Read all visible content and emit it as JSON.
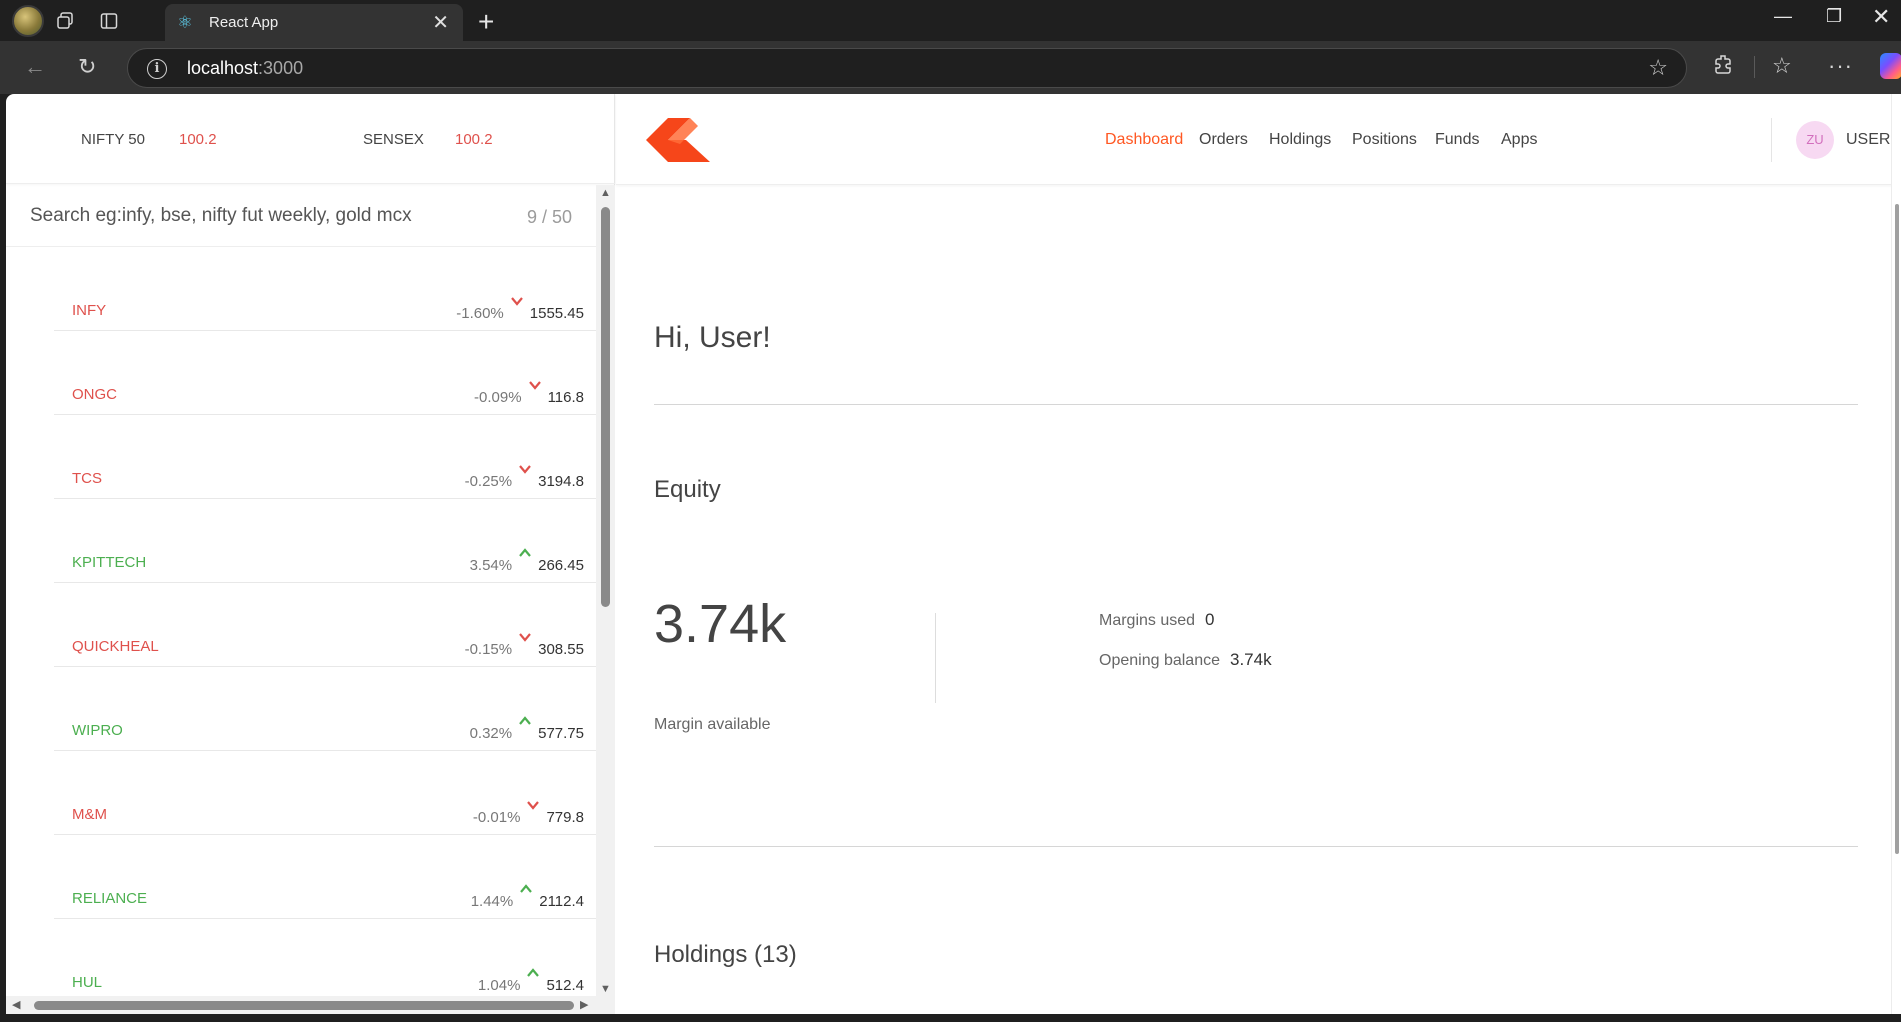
{
  "browser": {
    "tab_title": "React App",
    "url_host": "localhost",
    "url_port": ":3000"
  },
  "indices": [
    {
      "name": "NIFTY 50",
      "value": "100.2"
    },
    {
      "name": "SENSEX",
      "value": "100.2"
    }
  ],
  "search": {
    "placeholder": "Search eg:infy, bse, nifty fut weekly, gold mcx",
    "count": "9 / 50"
  },
  "watchlist": [
    {
      "name": "INFY",
      "percent": "-1.60%",
      "price": "1555.45",
      "direction": "down"
    },
    {
      "name": "ONGC",
      "percent": "-0.09%",
      "price": "116.8",
      "direction": "down"
    },
    {
      "name": "TCS",
      "percent": "-0.25%",
      "price": "3194.8",
      "direction": "down"
    },
    {
      "name": "KPITTECH",
      "percent": "3.54%",
      "price": "266.45",
      "direction": "up"
    },
    {
      "name": "QUICKHEAL",
      "percent": "-0.15%",
      "price": "308.55",
      "direction": "down"
    },
    {
      "name": "WIPRO",
      "percent": "0.32%",
      "price": "577.75",
      "direction": "up"
    },
    {
      "name": "M&M",
      "percent": "-0.01%",
      "price": "779.8",
      "direction": "down"
    },
    {
      "name": "RELIANCE",
      "percent": "1.44%",
      "price": "2112.4",
      "direction": "up"
    },
    {
      "name": "HUL",
      "percent": "1.04%",
      "price": "512.4",
      "direction": "up"
    }
  ],
  "nav": {
    "items": [
      "Dashboard",
      "Orders",
      "Holdings",
      "Positions",
      "Funds",
      "Apps"
    ],
    "active": "Dashboard",
    "avatar_initials": "ZU",
    "user_id": "USERID"
  },
  "dashboard": {
    "greeting": "Hi, User!",
    "equity_title": "Equity",
    "margin_available_value": "3.74k",
    "margin_available_label": "Margin available",
    "margins_used_label": "Margins used",
    "margins_used_value": "0",
    "opening_balance_label": "Opening balance",
    "opening_balance_value": "3.74k",
    "holdings_title": "Holdings (13)"
  },
  "colors": {
    "down": "#df514c",
    "up": "#4caf50",
    "accent": "#ff5722"
  }
}
